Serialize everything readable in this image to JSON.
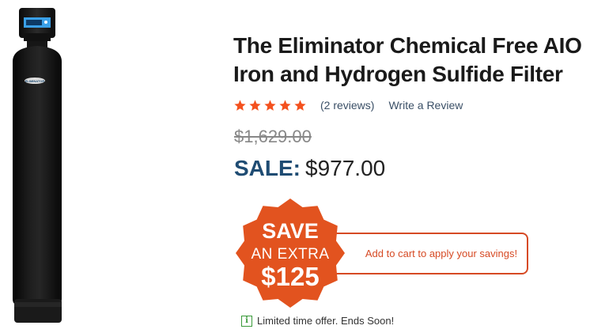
{
  "product": {
    "title": "The Eliminator Chemical Free AIO Iron and Hydrogen Sulfide Filter",
    "image_icon": "water-filter-tank-image",
    "rating": {
      "stars": 5,
      "max_stars": 5,
      "star_color": "#f4511e",
      "reviews_label": "(2 reviews)",
      "write_review_label": "Write a Review"
    },
    "pricing": {
      "original_price": "$1,629.00",
      "sale_label": "SALE:",
      "sale_price": "$977.00"
    },
    "promo": {
      "badge_line1": "SAVE",
      "badge_line2": "AN EXTRA",
      "badge_line3": "$125",
      "badge_color": "#e2531f",
      "cta_text": "Add to cart to apply your savings!",
      "cta_color": "#d64a24"
    },
    "notice": {
      "icon": "info-icon",
      "text": "Limited time offer. Ends Soon!"
    }
  }
}
